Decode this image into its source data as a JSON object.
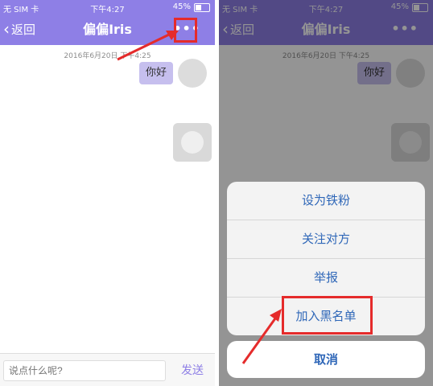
{
  "colors": {
    "accent": "#8e7fe6",
    "sheet_text": "#2f67b8",
    "annotation": "#e52b2b"
  },
  "status": {
    "carrier": "无 SIM 卡",
    "wifi_icon": "wifi-icon",
    "time": "下午4:27",
    "battery_pct": "45%",
    "battery_icon": "battery-icon"
  },
  "nav": {
    "back_label": "返回",
    "title": "偏偏Iris",
    "more_label": "•••"
  },
  "chat": {
    "timestamp": "2016年6月20日 下午4:25",
    "message": "你好"
  },
  "composer": {
    "placeholder": "说点什么呢?",
    "send_label": "发送"
  },
  "sheet": {
    "items": [
      "设为铁粉",
      "关注对方",
      "举报",
      "加入黑名单"
    ],
    "cancel_label": "取消"
  }
}
